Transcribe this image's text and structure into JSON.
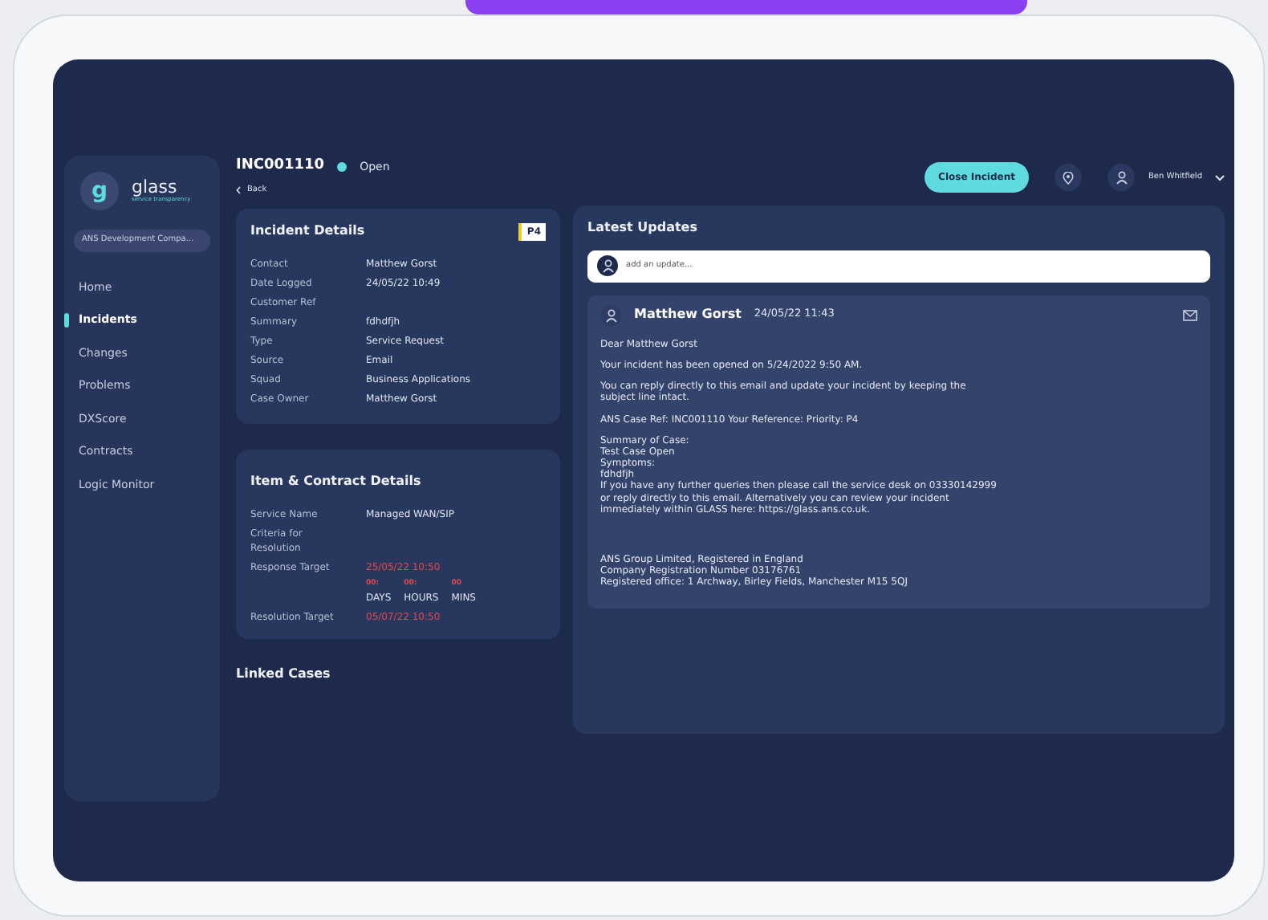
{
  "sidebar": {
    "logo": {
      "letter": "g",
      "name": "glass",
      "tagline": "service transparency"
    },
    "company": "ANS Development Compa...",
    "items": [
      {
        "label": "Home",
        "selected": false
      },
      {
        "label": "Incidents",
        "selected": true
      },
      {
        "label": "Changes",
        "selected": false
      },
      {
        "label": "Problems",
        "selected": false
      },
      {
        "label": "DXScore",
        "selected": false
      },
      {
        "label": "Contracts",
        "selected": false
      },
      {
        "label": "Logic Monitor",
        "selected": false
      }
    ]
  },
  "header": {
    "incident_id": "INC001110",
    "status": "Open",
    "back": "Back",
    "close_button": "Close Incident",
    "user_name": "Ben Whitfield"
  },
  "incident_details": {
    "title": "Incident Details",
    "priority": "P4",
    "fields": [
      {
        "label": "Contact",
        "value": "Matthew Gorst"
      },
      {
        "label": "Date Logged",
        "value": "24/05/22 10:49"
      },
      {
        "label": "Customer Ref"
      },
      {
        "label": "Summary",
        "value": "fdhdfjh"
      },
      {
        "label": "Type",
        "value": "Service Request"
      },
      {
        "label": "Source",
        "value": "Email"
      },
      {
        "label": "Squad",
        "value": "Business Applications"
      },
      {
        "label": "Case Owner",
        "value": "Matthew Gorst"
      }
    ]
  },
  "contract_details": {
    "title": "Item & Contract Details",
    "fields": [
      {
        "kind": "text",
        "label": "Service Name",
        "value": "Managed WAN/SIP"
      },
      {
        "kind": "text",
        "label": "Criteria for Resolution"
      },
      {
        "kind": "overdue",
        "label": "Response Target",
        "value": "25/05/22 10:50"
      },
      {
        "kind": "countdown",
        "parts": [
          {
            "value": "00:",
            "unit": "DAYS"
          },
          {
            "value": "00:",
            "unit": "HOURS"
          },
          {
            "value": "00",
            "unit": "MINS"
          }
        ]
      },
      {
        "kind": "overdue",
        "label": "Resolution Target",
        "value": "05/07/22 10:50"
      }
    ]
  },
  "linked_cases": {
    "title": "Linked Cases"
  },
  "updates": {
    "title": "Latest Updates",
    "input": {
      "placeholder": "add an update..."
    },
    "entries": [
      {
        "author": "Matthew Gorst",
        "time": "24/05/22 11:43",
        "paragraphs": [
          [
            "Dear Matthew Gorst"
          ],
          [
            "Your incident has been opened on 5/24/2022 9:50 AM."
          ],
          [
            "You can reply directly to this email and update your incident by keeping the",
            "subject line intact."
          ],
          [
            "ANS Case Ref: INC001110 Your Reference: Priority:      P4"
          ],
          [
            "Summary of Case:",
            "Test Case Open",
            "Symptoms:",
            "fdhdfjh",
            "If you have any further queries then please call the service desk on 03330142999",
            "or reply directly to this email. Alternatively you can review your incident",
            "immediately within GLASS here: https://glass.ans.co.uk."
          ],
          [
            "ANS Group Limited, Registered in England",
            "Company Registration Number 03176761",
            "Registered office: 1 Archway, Birley Fields, Manchester M15 5QJ"
          ]
        ]
      }
    ]
  }
}
